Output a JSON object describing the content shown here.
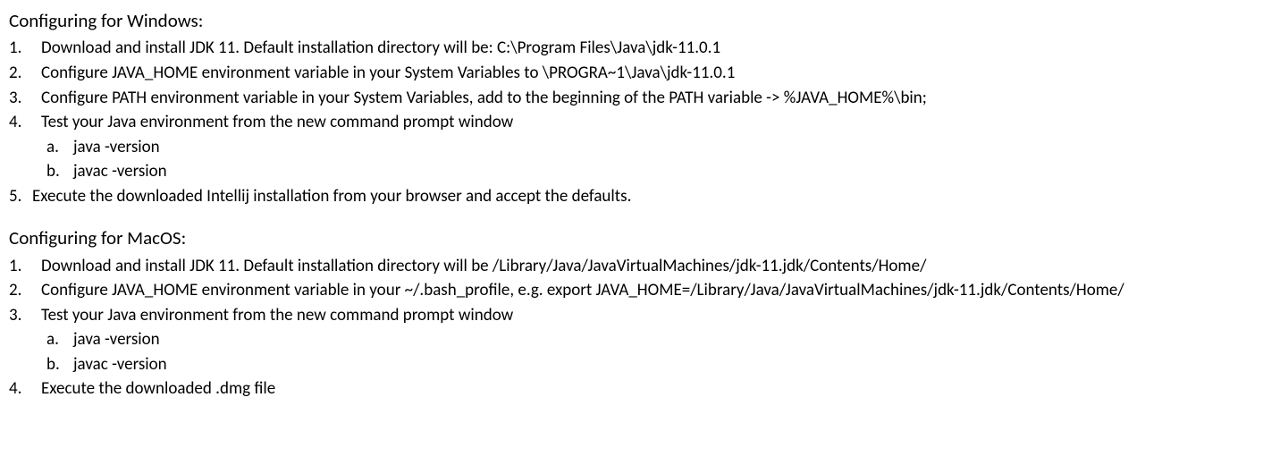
{
  "windows": {
    "heading": "Configuring for Windows:",
    "steps": [
      "Download and install JDK 11. Default installation directory will be: C:\\Program Files\\Java\\jdk-11.0.1",
      "Configure JAVA_HOME environment variable in your System Variables to \\PROGRA~1\\Java\\jdk-11.0.1",
      "Configure PATH environment variable in your System Variables, add to the beginning of the PATH variable -> %JAVA_HOME%\\bin;",
      "Test your Java environment from the new command prompt window"
    ],
    "substeps": [
      "java -version",
      "javac -version"
    ],
    "step5": "Execute the downloaded Intellij installation from your browser and accept the defaults."
  },
  "macos": {
    "heading": "Configuring for MacOS:",
    "steps": [
      "Download and install JDK 11. Default installation directory will be /Library/Java/JavaVirtualMachines/jdk-11.jdk/Contents/Home/",
      "Configure JAVA_HOME environment variable in your ~/.bash_profile, e.g. export JAVA_HOME=/Library/Java/JavaVirtualMachines/jdk-11.jdk/Contents/Home/",
      "Test your Java environment from the new command prompt window"
    ],
    "substeps": [
      "java -version",
      "javac -version"
    ],
    "step4": "Execute the downloaded .dmg file"
  }
}
